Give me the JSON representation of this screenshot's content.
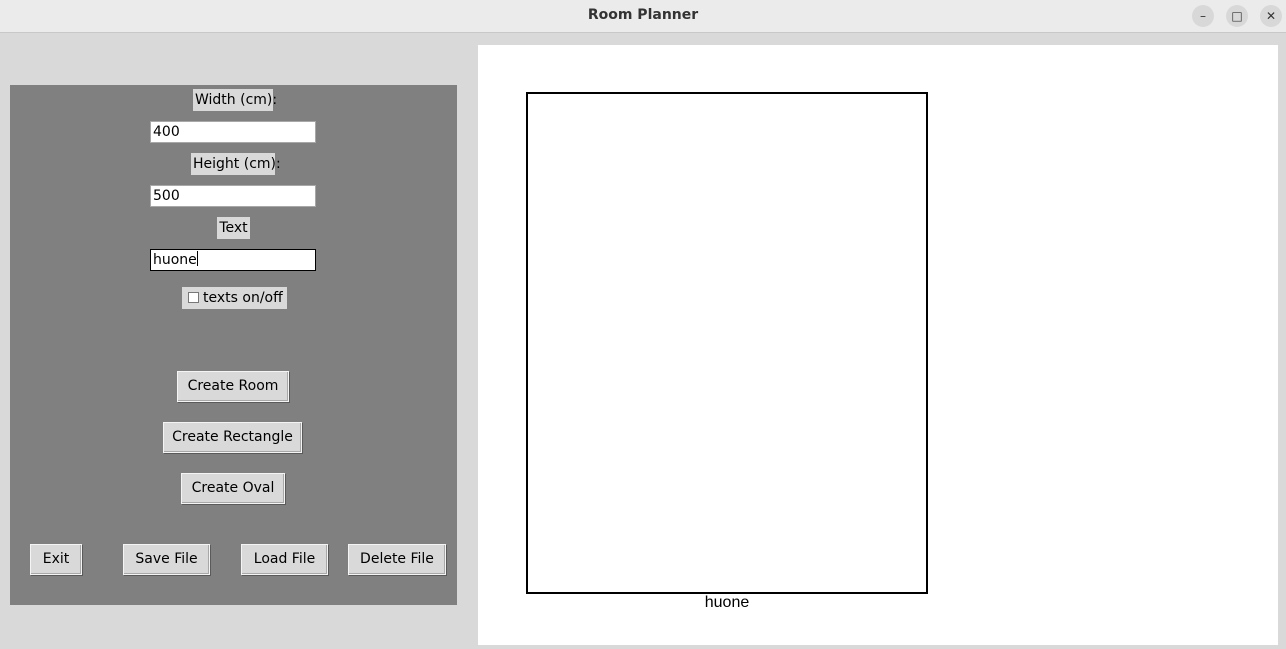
{
  "window": {
    "title": "Room Planner",
    "controls": {
      "minimize": "–",
      "maximize": "□",
      "close": "✕"
    }
  },
  "form": {
    "width_label": "Width (cm):",
    "width_value": "400",
    "height_label": "Height (cm):",
    "height_value": "500",
    "text_label": "Text",
    "text_value": "huone",
    "texts_toggle_label": "texts on/off",
    "texts_toggle_checked": false
  },
  "buttons": {
    "create_room": "Create Room",
    "create_rectangle": "Create Rectangle",
    "create_oval": "Create Oval",
    "exit": "Exit",
    "save_file": "Save File",
    "load_file": "Load File",
    "delete_file": "Delete File"
  },
  "canvas": {
    "shapes": [
      {
        "type": "room",
        "label": "huone",
        "width_cm": 400,
        "height_cm": 500
      }
    ]
  }
}
